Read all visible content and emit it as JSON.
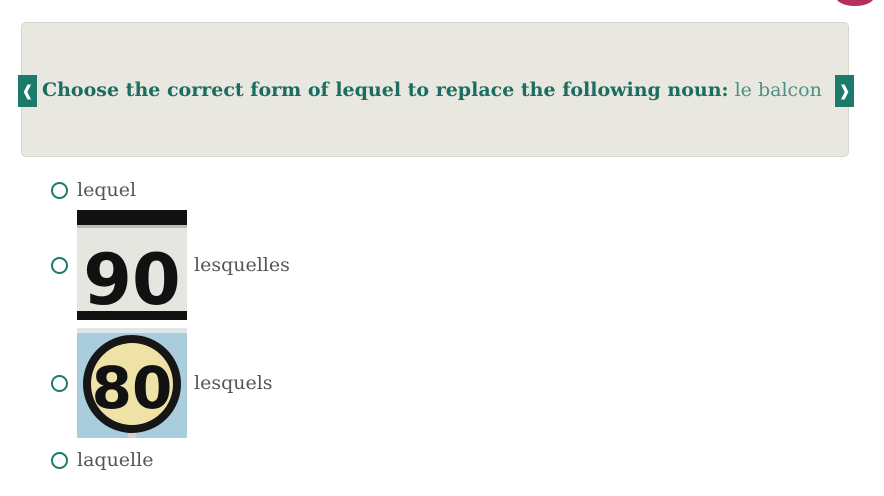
{
  "question": {
    "prompt": "Choose the correct form of lequel to replace the following noun:",
    "noun": "le balcon"
  },
  "nav": {
    "prev_icon": "❰",
    "next_icon": "❱"
  },
  "options": [
    {
      "label": "lequel"
    },
    {
      "label": "lesquelles",
      "image": {
        "sign_text": "90"
      }
    },
    {
      "label": "lesquels",
      "image": {
        "sign_text": "80"
      }
    },
    {
      "label": "laquelle"
    }
  ],
  "colors": {
    "accent": "#1b7a6c",
    "panel_bg": "#e8e8e0",
    "badge": "#b5305a"
  }
}
